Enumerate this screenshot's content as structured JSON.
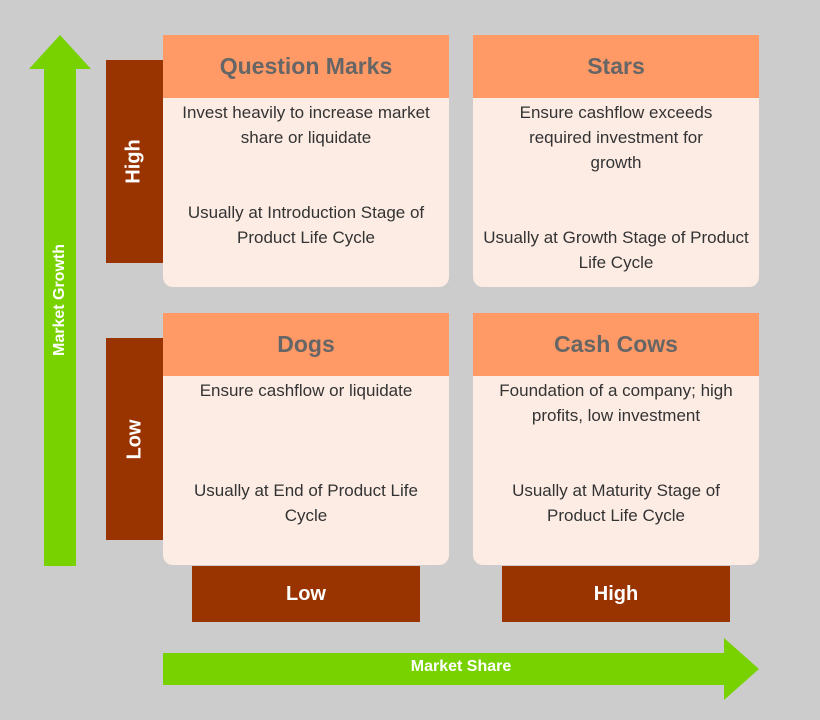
{
  "colors": {
    "background": "#cccccc",
    "arrow": "#77d200",
    "axis_box": "#993300",
    "card_header": "#ff9966",
    "card_body": "#fdece4",
    "header_text": "#666666"
  },
  "y_axis": {
    "label": "Market Growth",
    "levels": [
      "High",
      "Low"
    ]
  },
  "x_axis": {
    "label": "Market Share",
    "levels": [
      "Low",
      "High"
    ]
  },
  "quadrants": [
    {
      "title": "Question Marks",
      "strategy": "Invest heavily to increase market share or liquidate",
      "stage": "Usually at Introduction Stage of Product Life Cycle"
    },
    {
      "title": "Stars",
      "strategy": "Ensure cashflow exceeds required investment for growth",
      "stage": "Usually at Growth Stage of Product Life Cycle"
    },
    {
      "title": "Dogs",
      "strategy": "Ensure cashflow or liquidate",
      "stage": "Usually at End of Product Life Cycle"
    },
    {
      "title": "Cash Cows",
      "strategy": "Foundation of a company; high profits, low investment",
      "stage": "Usually at Maturity Stage of Product Life Cycle"
    }
  ]
}
